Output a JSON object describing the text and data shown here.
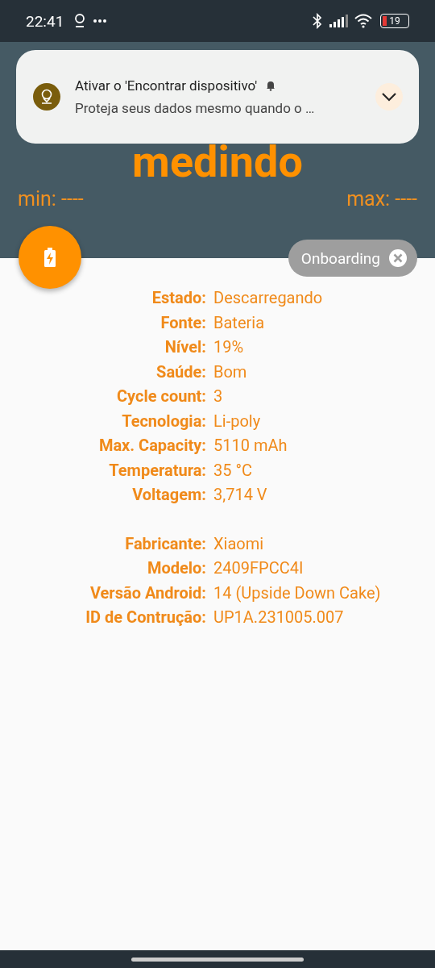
{
  "status_bar": {
    "time": "22:41",
    "battery": "19"
  },
  "notification": {
    "title": "Ativar o 'Encontrar dispositivo'",
    "text": "Proteja seus dados mesmo quando o …",
    "expanded": false
  },
  "reading": {
    "value": "medindo",
    "min": "min: ----",
    "max": "max: ----"
  },
  "chip": {
    "label": "Onboarding"
  },
  "info_groups": [
    {
      "rows": [
        {
          "label": "Estado:",
          "value": "Descarregando"
        },
        {
          "label": "Fonte:",
          "value": "Bateria"
        },
        {
          "label": "Nível:",
          "value": "19%"
        },
        {
          "label": "Saúde:",
          "value": "Bom"
        },
        {
          "label": "Cycle count:",
          "value": "3"
        },
        {
          "label": "Tecnologia:",
          "value": "Li-poly"
        },
        {
          "label": "Max. Capacity:",
          "value": "5110 mAh"
        },
        {
          "label": "Temperatura:",
          "value": "35 °C"
        },
        {
          "label": "Voltagem:",
          "value": "3,714 V"
        }
      ]
    },
    {
      "rows": [
        {
          "label": "Fabricante:",
          "value": "Xiaomi"
        },
        {
          "label": "Modelo:",
          "value": "2409FPCC4I"
        },
        {
          "label": "Versão Android:",
          "value": "14 (Upside Down Cake)"
        },
        {
          "label": "ID de Contrução:",
          "value": "UP1A.231005.007"
        }
      ]
    }
  ]
}
